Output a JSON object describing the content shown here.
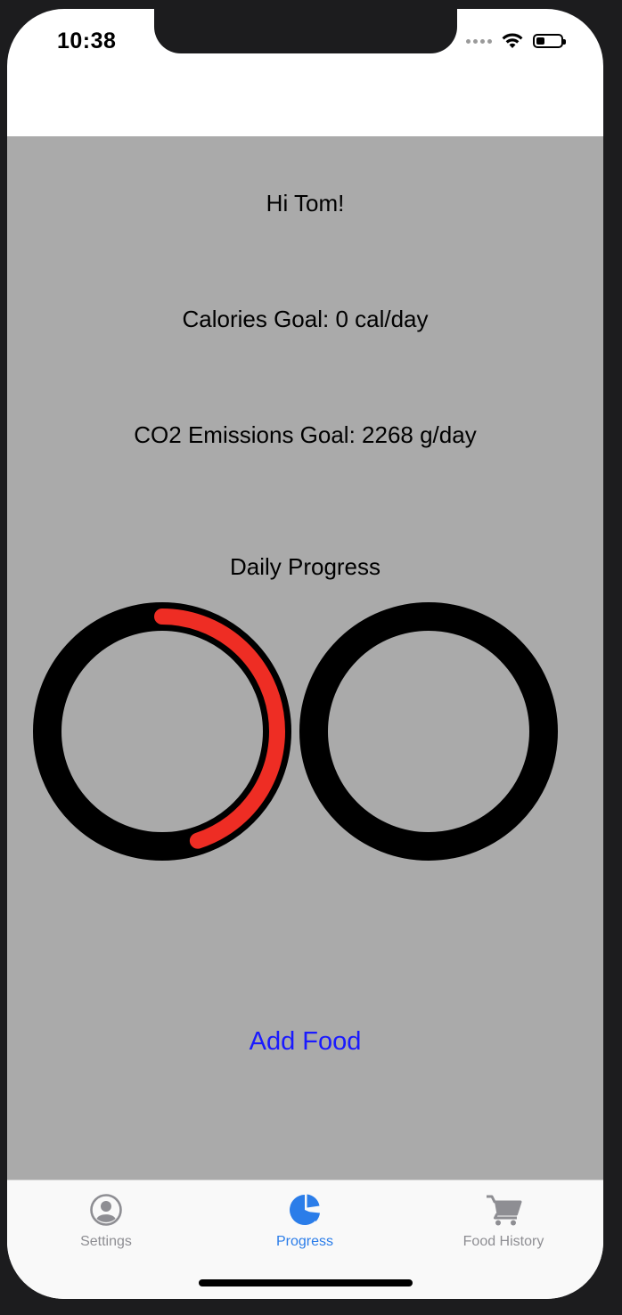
{
  "status_bar": {
    "time": "10:38",
    "battery_level": 0.35
  },
  "main": {
    "greeting": "Hi Tom!",
    "calories_goal": "Calories Goal: 0 cal/day",
    "co2_goal": "CO2 Emissions Goal: 2268 g/day",
    "daily_progress_title": "Daily Progress",
    "add_food_label": "Add Food",
    "rings": [
      {
        "name": "calories",
        "progress": 0.45,
        "color": "#ee2d24"
      },
      {
        "name": "co2",
        "progress": 0.0,
        "color": "#ee2d24"
      }
    ]
  },
  "tab_bar": {
    "tabs": [
      {
        "label": "Settings",
        "icon": "person-circle-icon",
        "active": false
      },
      {
        "label": "Progress",
        "icon": "pie-chart-icon",
        "active": true
      },
      {
        "label": "Food History",
        "icon": "cart-icon",
        "active": false
      }
    ],
    "active_color": "#2b7de9",
    "inactive_color": "#8e8e93"
  }
}
